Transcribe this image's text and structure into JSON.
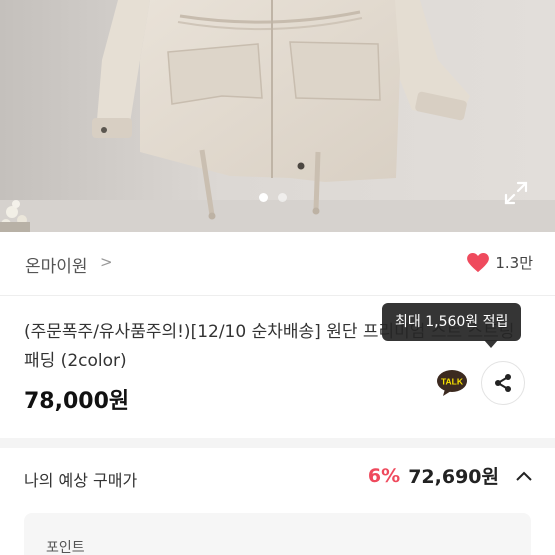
{
  "gallery": {
    "slide_count": 2,
    "active_slide": 1,
    "expand_icon": "expand-icon"
  },
  "store": {
    "name": "온마이원",
    "chevron": ">",
    "like_icon": "heart-icon",
    "like_count": "1.3만",
    "like_color": "#ef4a5d"
  },
  "product": {
    "title": "(주문폭주/유사품주의!)[12/10 순차배송] 원단 프리미엄 스트 스트링 패딩 (2color)",
    "price": "78,000원"
  },
  "tooltip": {
    "text": "최대 1,560원 적립"
  },
  "actions": {
    "talk_label": "TALK",
    "talk_icon": "kakaotalk-icon",
    "share_icon": "share-icon"
  },
  "estimate": {
    "label": "나의 예상 구매가",
    "discount": "6%",
    "price": "72,690원",
    "toggle_icon": "chevron-up-icon",
    "accent": "#ef4a5d"
  },
  "points": {
    "label": "포인트"
  }
}
